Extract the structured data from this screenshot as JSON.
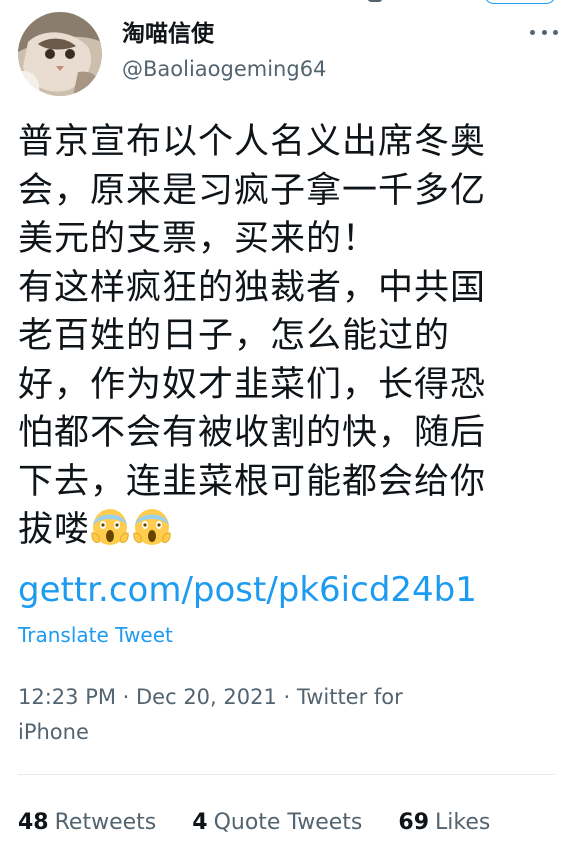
{
  "tweet": {
    "author": {
      "name": "淘喵信使",
      "handle": "@Baoliaogeming64"
    },
    "text_lines": [
      "普京宣布以个人名义出席冬奥",
      "会，原来是习疯子拿一千多亿",
      "美元的支票，买来的！",
      "有这样疯狂的独裁者，中共国",
      "老百姓的日子，怎么能过的",
      "好，作为奴才韭菜们，长得恐",
      "怕都不会有被收割的快，随后",
      "下去，连韭菜根可能都会给你",
      "拔喽"
    ],
    "emojis": [
      "face-screaming-in-fear",
      "face-screaming-in-fear"
    ],
    "link": "gettr.com/post/pk6icd24b1",
    "translate_label": "Translate Tweet",
    "meta_line1": "12:23 PM · Dec 20, 2021 · Twitter for",
    "meta_line2": "iPhone",
    "stats": {
      "retweets_count": "48",
      "retweets_label": "Retweets",
      "quotes_count": "4",
      "quotes_label": "Quote Tweets",
      "likes_count": "69",
      "likes_label": "Likes"
    }
  },
  "colors": {
    "link_blue": "#1d9bf0",
    "text_primary": "#0f1419",
    "text_secondary": "#536471",
    "divider": "#e6ecf0"
  },
  "icons": {
    "more": "more-horizontal-icon"
  }
}
